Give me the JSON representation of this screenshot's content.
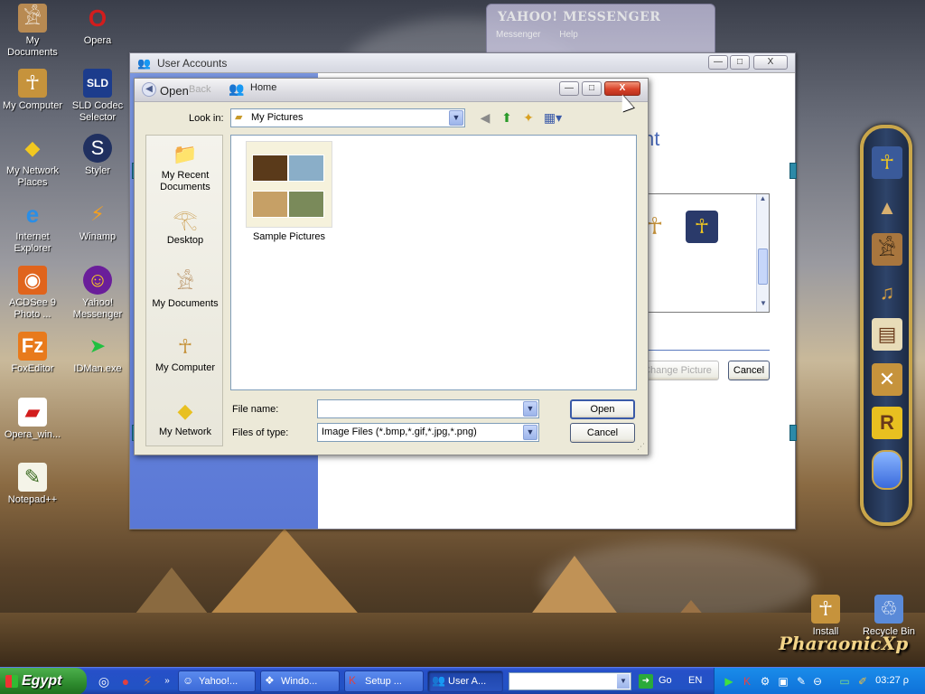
{
  "desktop": {
    "icons": [
      {
        "label": "My Documents",
        "icon": "seated-figure-icon"
      },
      {
        "label": "Opera",
        "icon": "opera-icon"
      },
      {
        "label": "My Computer",
        "icon": "pharaoh-bust-icon"
      },
      {
        "label": "SLD Codec Selector",
        "icon": "sld-icon"
      },
      {
        "label": "My Network Places",
        "icon": "network-places-icon"
      },
      {
        "label": "Styler",
        "icon": "styler-icon"
      },
      {
        "label": "Internet Explorer",
        "icon": "internet-explorer-icon"
      },
      {
        "label": "Winamp",
        "icon": "winamp-icon"
      },
      {
        "label": "ACDSee 9 Photo ...",
        "icon": "acdsee-icon"
      },
      {
        "label": "Yahoo! Messenger",
        "icon": "yahoo-messenger-icon"
      },
      {
        "label": "FoxEditor",
        "icon": "foxeditor-icon"
      },
      {
        "label": "IDMan.exe",
        "icon": "idman-icon"
      },
      {
        "label": "Opera_win...",
        "icon": "opera-installer-icon"
      },
      {
        "label": "Notepad++",
        "icon": "notepad-plus-icon"
      },
      {
        "label": "Install",
        "icon": "install-icon"
      },
      {
        "label": "Recycle Bin",
        "icon": "recycle-bin-icon"
      }
    ],
    "brand": "PharaonicXp"
  },
  "yahoo_window": {
    "title": "YAHOO! MESSENGER",
    "menu": [
      "Messenger",
      "Help"
    ]
  },
  "user_accounts": {
    "title": "User Accounts",
    "heading_fragment": "nt",
    "change_picture_label": "Change Picture",
    "cancel_label": "Cancel"
  },
  "open_dialog": {
    "title": "Open",
    "back_label": "Back",
    "home_label": "Home",
    "look_in_label": "Look in:",
    "look_in_value": "My Pictures",
    "places": [
      {
        "label": "My Recent Documents",
        "icon": "recent-documents-icon"
      },
      {
        "label": "Desktop",
        "icon": "desktop-eye-icon"
      },
      {
        "label": "My Documents",
        "icon": "my-documents-icon"
      },
      {
        "label": "My Computer",
        "icon": "my-computer-icon"
      },
      {
        "label": "My Network",
        "icon": "my-network-icon"
      }
    ],
    "files": [
      {
        "name": "Sample Pictures",
        "icon": "picture-folder-icon"
      }
    ],
    "file_name_label": "File name:",
    "file_name_value": "",
    "files_of_type_label": "Files of type:",
    "files_of_type_value": "Image Files (*.bmp,*.gif,*.jpg,*.png)",
    "open_button": "Open",
    "cancel_button": "Cancel",
    "minimize": "—",
    "maximize": "□",
    "close": "X"
  },
  "taskbar": {
    "start_label": "Egypt",
    "tasks": [
      {
        "label": "Yahoo!...",
        "icon": "yahoo-icon"
      },
      {
        "label": "Windo...",
        "icon": "windows-icon"
      },
      {
        "label": "Setup ...",
        "icon": "setup-icon"
      },
      {
        "label": "User A...",
        "icon": "user-accounts-icon"
      }
    ],
    "address_value": "",
    "go_label": "Go",
    "language": "EN",
    "clock": "03:27 ρ"
  },
  "colors": {
    "taskbar_blue": "#2252c4",
    "start_green": "#2d8a2d",
    "close_red": "#d8432a",
    "dock_gold": "#c9a64a"
  }
}
